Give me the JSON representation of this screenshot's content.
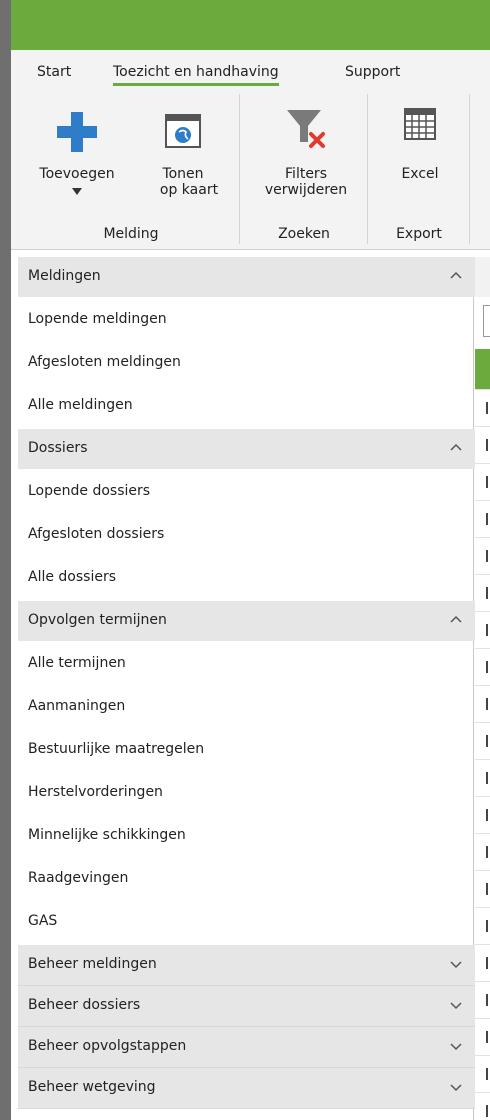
{
  "ribbon": {
    "tabs": [
      {
        "label": "Start"
      },
      {
        "label": "Toezicht en handhaving"
      },
      {
        "label": "Support"
      }
    ],
    "buttons": {
      "toevoegen": "Toevoegen",
      "tonen_line1": "Tonen",
      "tonen_line2": "op kaart",
      "filters_line1": "Filters",
      "filters_line2": "verwijderen",
      "excel": "Excel"
    },
    "groups": {
      "melding": "Melding",
      "zoeken": "Zoeken",
      "export": "Export"
    }
  },
  "nav": {
    "sections": [
      {
        "title": "Meldingen",
        "expanded": true,
        "items": [
          "Lopende meldingen",
          "Afgesloten meldingen",
          "Alle meldingen"
        ]
      },
      {
        "title": "Dossiers",
        "expanded": true,
        "items": [
          "Lopende dossiers",
          "Afgesloten dossiers",
          "Alle dossiers"
        ]
      },
      {
        "title": "Opvolgen termijnen",
        "expanded": true,
        "items": [
          "Alle termijnen",
          "Aanmaningen",
          "Bestuurlijke maatregelen",
          "Herstelvorderingen",
          "Minnelijke schikkingen",
          "Raadgevingen",
          "GAS"
        ]
      },
      {
        "title": "Beheer meldingen",
        "expanded": false,
        "items": []
      },
      {
        "title": "Beheer dossiers",
        "expanded": false,
        "items": []
      },
      {
        "title": "Beheer opvolgstappen",
        "expanded": false,
        "items": []
      },
      {
        "title": "Beheer wetgeving",
        "expanded": false,
        "items": []
      }
    ]
  },
  "colors": {
    "accent": "#6bab3e",
    "add_icon": "#2f7dc8",
    "remove_icon": "#e03a2f",
    "ribbon_bg": "#f3f3f3",
    "section_bg": "#e6e6e6"
  },
  "icons": {
    "add": "plus-icon",
    "map": "globe-window-icon",
    "filter": "funnel-remove-icon",
    "excel": "grid-icon",
    "expanded": "chevron-up-icon",
    "collapsed": "chevron-down-icon"
  }
}
